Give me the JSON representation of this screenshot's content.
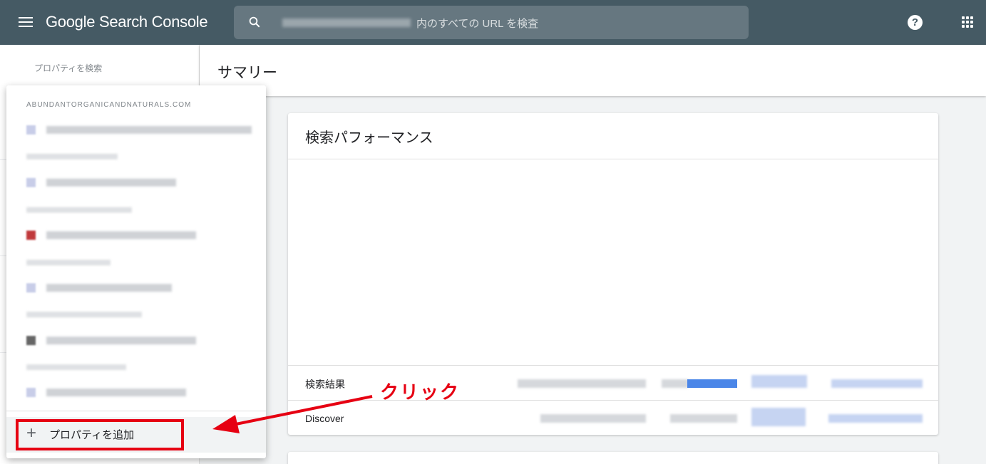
{
  "header": {
    "brand": "Google Search Console",
    "search_placeholder": "内のすべての URL を検査",
    "help_label": "?"
  },
  "sidebar": {
    "property_search_label": "プロパティを検索"
  },
  "dropdown": {
    "group_label": "ABUNDANTORGANICANDNATURALS.COM",
    "add_property_label": "プロパティを追加",
    "add_icon": "+"
  },
  "main": {
    "title": "サマリー",
    "card": {
      "title": "検索パフォーマンス",
      "rows": [
        {
          "label": "検索結果"
        },
        {
          "label": "Discover"
        }
      ]
    }
  },
  "annotation": {
    "text": "クリック",
    "color": "#e60012"
  },
  "colors": {
    "topbar": "#455a64",
    "accent_blue": "#4a86e8"
  }
}
